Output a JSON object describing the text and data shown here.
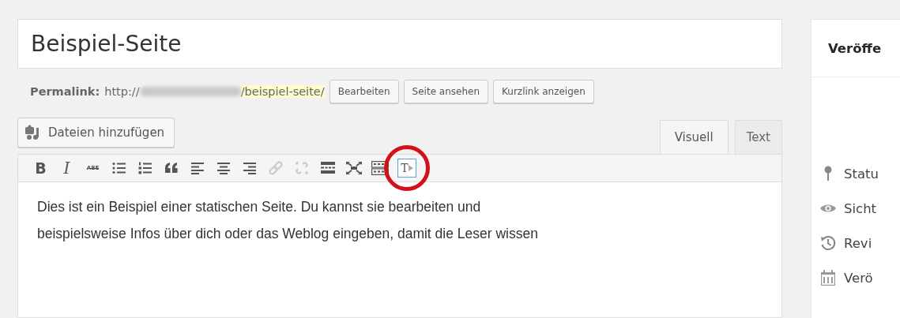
{
  "title": {
    "value": "Beispiel-Seite"
  },
  "permalink": {
    "label": "Permalink:",
    "prefix": "http://",
    "slug": "/beispiel-seite/",
    "buttons": [
      "Bearbeiten",
      "Seite ansehen",
      "Kurzlink anzeigen"
    ]
  },
  "media_button": {
    "label": "Dateien hinzufügen"
  },
  "tabs": [
    {
      "label": "Visuell",
      "selected": true
    },
    {
      "label": "Text",
      "selected": false
    }
  ],
  "toolbar": [
    {
      "kind": "bold",
      "label": "B",
      "disabled": false,
      "highlighted": false,
      "circled": false
    },
    {
      "kind": "italic",
      "label": "I",
      "disabled": false,
      "highlighted": false,
      "circled": false
    },
    {
      "kind": "strike",
      "label": "ABE",
      "disabled": false,
      "highlighted": false,
      "circled": false
    },
    {
      "kind": "bullets",
      "disabled": false,
      "highlighted": false,
      "circled": false
    },
    {
      "kind": "numbers",
      "disabled": false,
      "highlighted": false,
      "circled": false
    },
    {
      "kind": "quote",
      "disabled": false,
      "highlighted": false,
      "circled": false
    },
    {
      "kind": "alignleft",
      "disabled": false,
      "highlighted": false,
      "circled": false
    },
    {
      "kind": "aligncenter",
      "disabled": false,
      "highlighted": false,
      "circled": false
    },
    {
      "kind": "alignright",
      "disabled": false,
      "highlighted": false,
      "circled": false
    },
    {
      "kind": "link",
      "disabled": true,
      "highlighted": false,
      "circled": false
    },
    {
      "kind": "unlink",
      "disabled": true,
      "highlighted": false,
      "circled": false
    },
    {
      "kind": "more",
      "disabled": false,
      "highlighted": false,
      "circled": false
    },
    {
      "kind": "fullscreen",
      "disabled": false,
      "highlighted": false,
      "circled": false
    },
    {
      "kind": "kitchensink",
      "disabled": false,
      "highlighted": false,
      "circled": false
    },
    {
      "kind": "texttool",
      "label": "T",
      "disabled": false,
      "highlighted": true,
      "circled": true
    }
  ],
  "content": {
    "text": "Dies ist ein Beispiel einer statischen Seite. Du kannst sie bearbeiten und\nbeispielsweise Infos über dich oder das Weblog eingeben, damit die Leser wissen"
  },
  "sidebar": {
    "title": "Veröffe",
    "items": [
      {
        "kind": "status",
        "label": "Statu"
      },
      {
        "kind": "visibility",
        "label": "Sicht"
      },
      {
        "kind": "revisions",
        "label": "Revi"
      },
      {
        "kind": "date",
        "label": "Verö"
      }
    ]
  }
}
